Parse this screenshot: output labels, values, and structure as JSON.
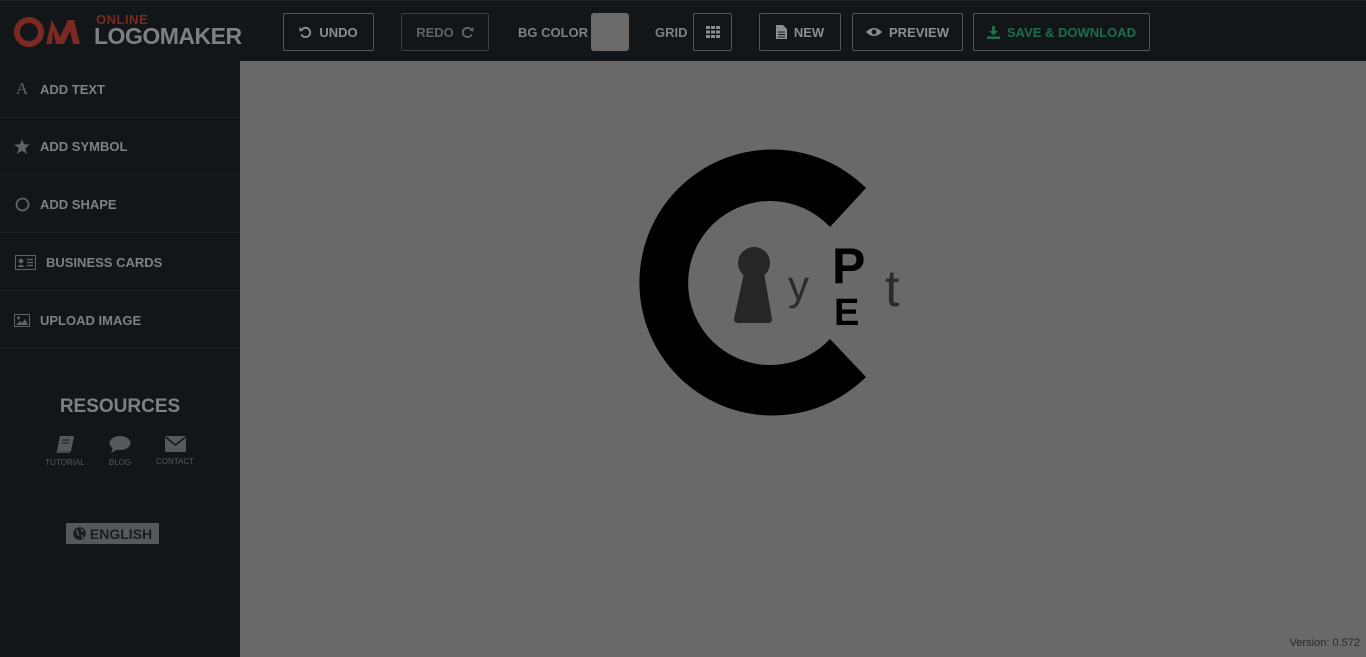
{
  "brand": {
    "online": "ONLINE",
    "logomaker": "LOGOMAKER",
    "mark": "OM"
  },
  "toolbar": {
    "undo": "UNDO",
    "redo": "REDO",
    "bg_color_label": "BG COLOR",
    "bg_color_value": "#6a6a6a",
    "grid_label": "GRID",
    "new": "NEW",
    "preview": "PREVIEW",
    "save_download": "SAVE & DOWNLOAD"
  },
  "sidebar": {
    "items": [
      {
        "label": "ADD TEXT",
        "icon": "text-icon"
      },
      {
        "label": "ADD SYMBOL",
        "icon": "star-icon"
      },
      {
        "label": "ADD SHAPE",
        "icon": "circle-icon"
      },
      {
        "label": "BUSINESS CARDS",
        "icon": "id-card-icon"
      },
      {
        "label": "UPLOAD IMAGE",
        "icon": "image-icon"
      }
    ],
    "resources_title": "RESOURCES",
    "resources": [
      {
        "label": "TUTORIAL",
        "icon": "book-icon"
      },
      {
        "label": "BLOG",
        "icon": "comment-icon"
      },
      {
        "label": "CONTACT",
        "icon": "envelope-icon"
      }
    ],
    "language": "ENGLISH"
  },
  "canvas": {
    "background": "#696969",
    "logo_texts": {
      "y": "y",
      "p": "P",
      "e": "E",
      "t": "t"
    },
    "version": "Version: 0.572"
  }
}
